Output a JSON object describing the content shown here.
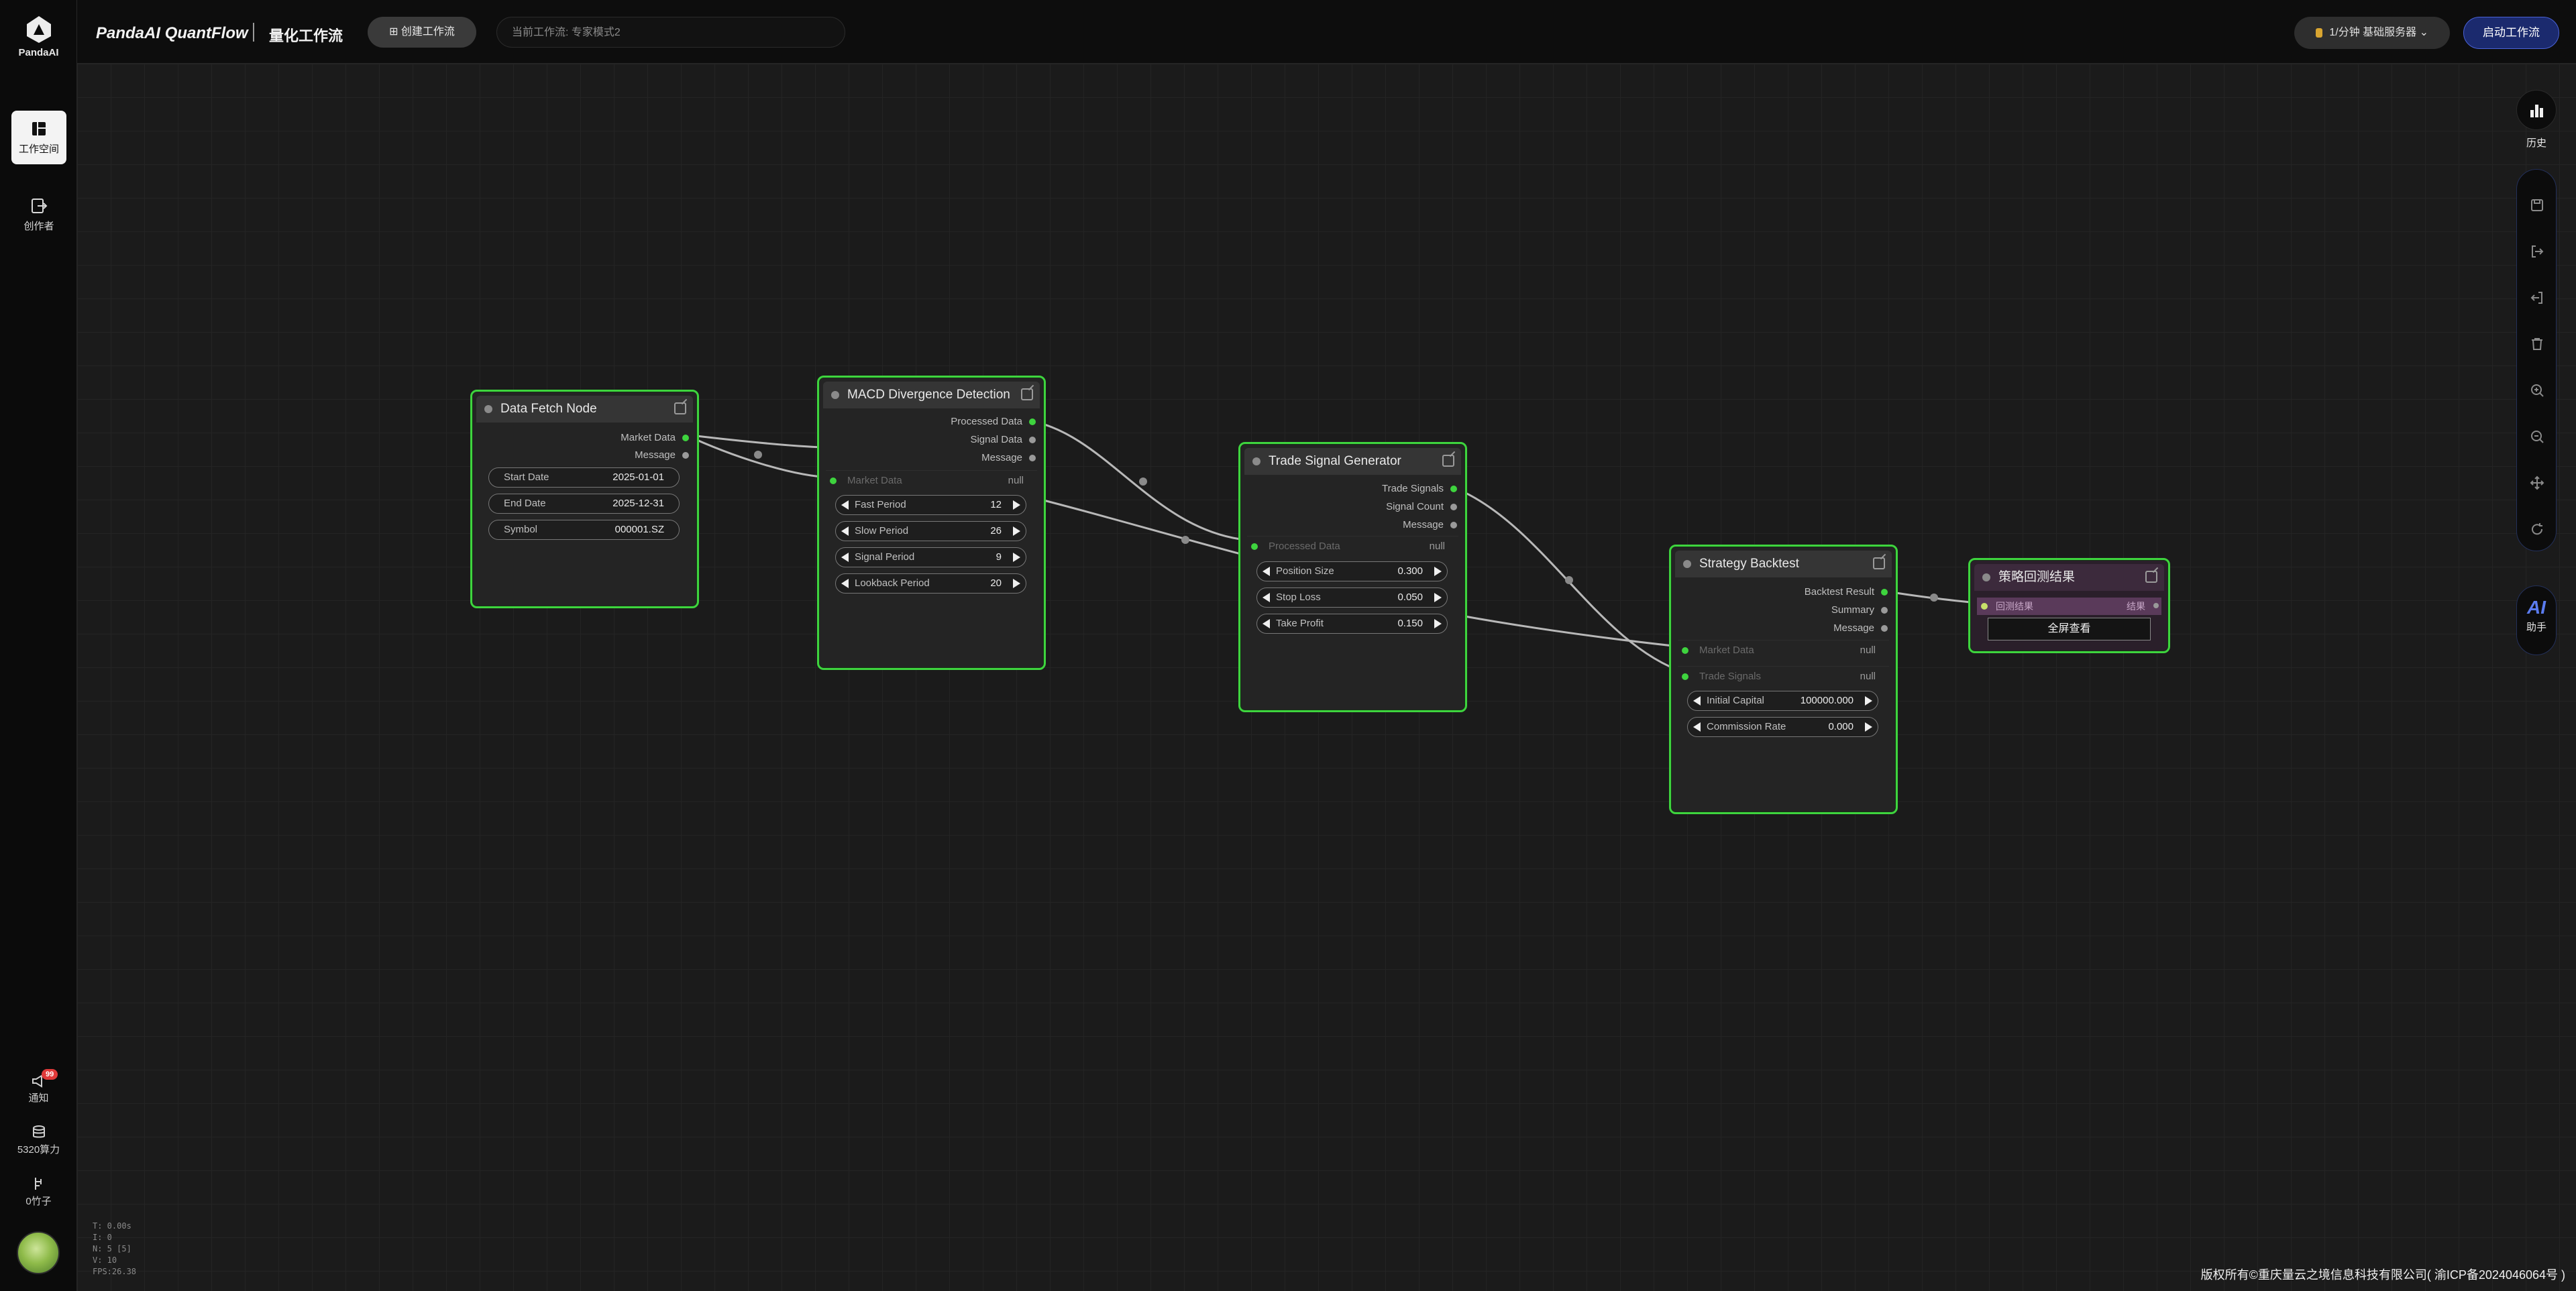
{
  "app": {
    "logo_text": "PandaAI",
    "title": "PandaAI QuantFlow",
    "subtitle": "量化工作流",
    "create_button": "创建工作流",
    "current_workflow": "当前工作流: 专家模式2",
    "server_label": "1/分钟  基础服务器",
    "start_button": "启动工作流"
  },
  "sidebar": {
    "items": [
      {
        "label": "工作空间",
        "icon": "workspace-icon",
        "active": true
      },
      {
        "label": "创作者",
        "icon": "creator-icon",
        "active": false
      }
    ],
    "bottom": {
      "notify_label": "通知",
      "notify_count": "99",
      "compute_label": "5320算力",
      "factor_label": "0竹子"
    }
  },
  "stats": {
    "t": "T: 0.00s",
    "i": "I: 0",
    "n": "N: 5 [5]",
    "v": "V: 10",
    "fps": "FPS:26.38"
  },
  "nodes": {
    "data_fetch": {
      "title": "Data Fetch Node",
      "outputs": [
        "Market Data",
        "Message"
      ],
      "fields": [
        {
          "label": "Start Date",
          "value": "2025-01-01"
        },
        {
          "label": "End Date",
          "value": "2025-12-31"
        },
        {
          "label": "Symbol",
          "value": "000001.SZ"
        }
      ]
    },
    "macd": {
      "title": "MACD Divergence Detection",
      "outputs": [
        "Processed Data",
        "Signal Data",
        "Message"
      ],
      "input": {
        "label": "Market Data",
        "value": "null"
      },
      "params": [
        {
          "label": "Fast Period",
          "value": "12"
        },
        {
          "label": "Slow Period",
          "value": "26"
        },
        {
          "label": "Signal Period",
          "value": "9"
        },
        {
          "label": "Lookback Period",
          "value": "20"
        }
      ]
    },
    "trade_signal": {
      "title": "Trade Signal Generator",
      "outputs": [
        "Trade Signals",
        "Signal Count",
        "Message"
      ],
      "input": {
        "label": "Processed Data",
        "value": "null"
      },
      "params": [
        {
          "label": "Position Size",
          "value": "0.300"
        },
        {
          "label": "Stop Loss",
          "value": "0.050"
        },
        {
          "label": "Take Profit",
          "value": "0.150"
        }
      ]
    },
    "backtest": {
      "title": "Strategy Backtest",
      "outputs": [
        "Backtest Result",
        "Summary",
        "Message"
      ],
      "inputs": [
        {
          "label": "Market Data",
          "value": "null"
        },
        {
          "label": "Trade Signals",
          "value": "null"
        }
      ],
      "params": [
        {
          "label": "Initial Capital",
          "value": "100000.000"
        },
        {
          "label": "Commission Rate",
          "value": "0.000"
        }
      ]
    },
    "result": {
      "title": "策略回测结果",
      "input_label": "回测结果",
      "input_tag": "结果",
      "button": "全屏查看"
    }
  },
  "right_toolbar": {
    "history_label": "历史",
    "tools": [
      "save-icon",
      "export-icon",
      "import-icon",
      "delete-icon",
      "zoom-in-icon",
      "zoom-out-icon",
      "move-icon",
      "refresh-icon"
    ],
    "ai_text": "AI",
    "ai_label": "助手"
  },
  "footer": {
    "copyright": "版权所有©重庆量云之境信息科技有限公司( 渝ICP备2024046064号 )"
  },
  "colors": {
    "node_border": "#3ed43e",
    "port_green": "#3ed43e",
    "accent_blue": "#4a62d6"
  }
}
